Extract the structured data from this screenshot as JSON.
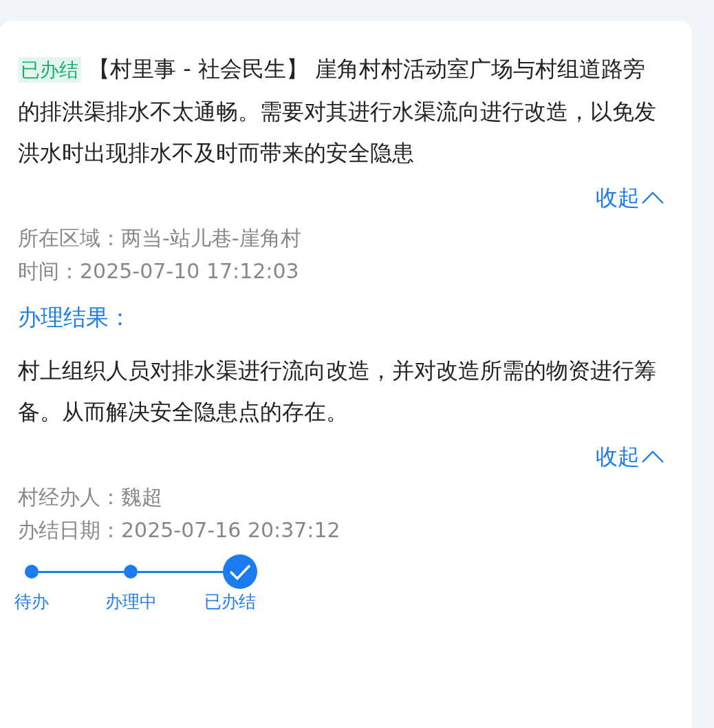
{
  "issue": {
    "status_badge": "已办结",
    "description": "【村里事 - 社会民生】 崖角村村活动室广场与村组道路旁的排洪渠排水不太通畅。需要对其进行水渠流向进行改造，以免发洪水时出现排水不及时而带来的安全隐患",
    "collapse_link": "收起",
    "meta": [
      {
        "label": "所在区域：",
        "value": "两当-站儿巷-崖角村"
      },
      {
        "label": "时间：",
        "value": "2025-07-10  17:12:03"
      }
    ]
  },
  "result": {
    "title": "办理结果：",
    "text": "村上组织人员对排水渠进行流向改造，并对改造所需的物资进行筹备。从而解决安全隐患点的存在。",
    "collapse_link": "收起",
    "meta": [
      {
        "label": "村经办人：",
        "value": "魏超"
      },
      {
        "label": "办结日期：",
        "value": "2025-07-16  20:37:12"
      }
    ]
  },
  "steps": [
    {
      "label": "待办",
      "selected": false
    },
    {
      "label": "办理中",
      "selected": false
    },
    {
      "label": "已办结",
      "selected": true
    }
  ]
}
